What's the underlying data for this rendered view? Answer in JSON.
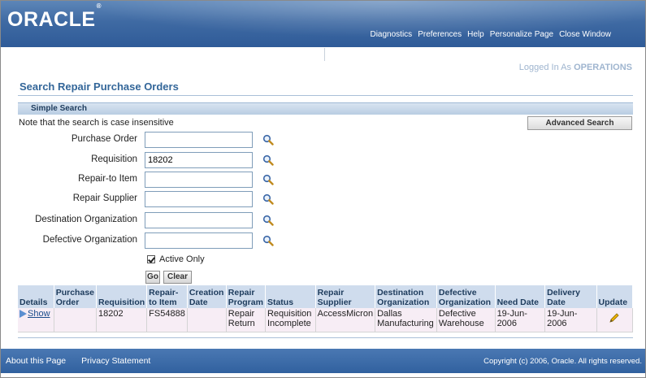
{
  "header": {
    "logo": "ORACLE",
    "logo_mark": "®",
    "links": [
      "Diagnostics",
      "Preferences",
      "Help",
      "Personalize Page",
      "Close Window"
    ]
  },
  "user": {
    "prefix": "Logged In As ",
    "name": "OPERATIONS"
  },
  "page_title": "Search Repair Purchase Orders",
  "simple_search": {
    "title": "Simple Search",
    "note": "Note that the search is case insensitive",
    "advanced_button": "Advanced Search",
    "fields": [
      {
        "label": "Purchase Order",
        "value": ""
      },
      {
        "label": "Requisition",
        "value": "18202"
      },
      {
        "label": "Repair-to Item",
        "value": ""
      },
      {
        "label": "Repair Supplier",
        "value": ""
      },
      {
        "label": "Destination Organization",
        "value": ""
      },
      {
        "label": "Defective Organization",
        "value": ""
      }
    ],
    "active_only_label": "Active Only",
    "go_label": "Go",
    "clear_label": "Clear"
  },
  "results": {
    "headers": {
      "details": "Details",
      "po_1": "Purchase",
      "po_2": "Order",
      "requisition": "Requisition",
      "rti_1": "Repair-",
      "rti_2": "to Item",
      "cd_1": "Creation",
      "cd_2": "Date",
      "rp_1": "Repair",
      "rp_2": "Program",
      "status": "Status",
      "rs_1": "Repair",
      "rs_2": "Supplier",
      "do_1": "Destination",
      "do_2": "Organization",
      "def_1": "Defective",
      "def_2": "Organization",
      "need_date": "Need Date",
      "dd_1": "Delivery",
      "dd_2": "Date",
      "update": "Update"
    },
    "row": {
      "details": "Show",
      "purchase_order": "",
      "requisition": "18202",
      "repair_to_item": "FS54888",
      "creation_date": "",
      "rp_1": "Repair",
      "rp_2": "Return",
      "st_1": "Requisition",
      "st_2": "Incomplete",
      "repair_supplier": "AccessMicron",
      "do_1": "Dallas",
      "do_2": "Manufacturing",
      "def_1": "Defective",
      "def_2": "Warehouse",
      "need_date": "19-Jun-2006",
      "delivery_date": "19-Jun-2006"
    }
  },
  "footer": {
    "links": [
      "About this Page",
      "Privacy Statement"
    ],
    "copyright": "Copyright (c) 2006, Oracle. All rights reserved."
  },
  "icons": {
    "search": "magnifier-icon",
    "update": "pencil-icon",
    "details": "triangle-right-icon"
  }
}
